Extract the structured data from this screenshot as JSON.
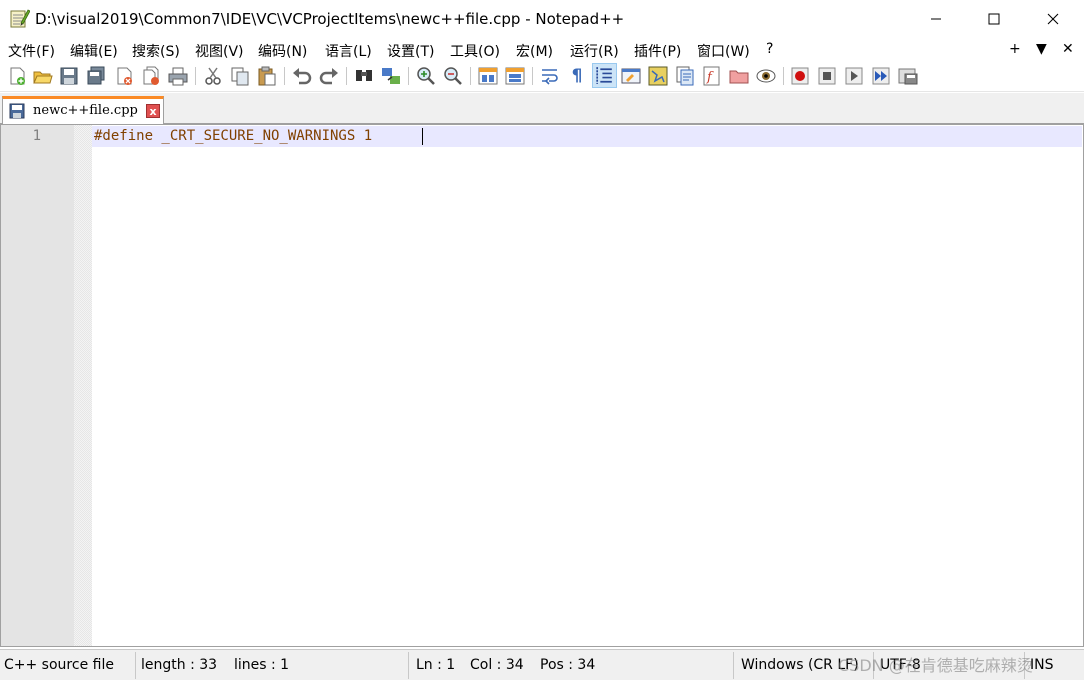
{
  "window": {
    "title": "D:\\visual2019\\Common7\\IDE\\VC\\VCProjectItems\\newc++file.cpp - Notepad++"
  },
  "menu": {
    "items": [
      "文件(F)",
      "编辑(E)",
      "搜索(S)",
      "视图(V)",
      "编码(N)",
      "语言(L)",
      "设置(T)",
      "工具(O)",
      "宏(M)",
      "运行(R)",
      "插件(P)",
      "窗口(W)",
      "?"
    ],
    "right": [
      "+",
      "▼",
      "✕"
    ]
  },
  "toolbar": {
    "icons": [
      "new-file-icon",
      "open-file-icon",
      "save-icon",
      "save-all-icon",
      "close-icon",
      "close-all-icon",
      "print-icon",
      "cut-icon",
      "copy-icon",
      "paste-icon",
      "undo-icon",
      "redo-icon",
      "find-icon",
      "replace-icon",
      "zoom-in-icon",
      "zoom-out-icon",
      "sync-vertical-icon",
      "sync-horizontal-icon",
      "word-wrap-icon",
      "show-all-chars-icon",
      "indent-guide-icon",
      "udl-icon",
      "doc-map-icon",
      "doc-list-icon",
      "function-list-icon",
      "folder-workspace-icon",
      "monitoring-icon",
      "record-macro-icon",
      "stop-macro-icon",
      "play-macro-icon",
      "run-macro-multiple-icon",
      "save-macro-icon"
    ],
    "show_all_chars_glyph": "¶"
  },
  "tabs": [
    {
      "label": "newc++file.cpp",
      "close": "x"
    }
  ],
  "editor": {
    "line_number": "1",
    "code": "#define _CRT_SECURE_NO_WARNINGS 1"
  },
  "status": {
    "file_type": "C++ source file",
    "length": "length : 33",
    "lines": "lines : 1",
    "ln": "Ln : 1",
    "col": "Col : 34",
    "pos": "Pos : 34",
    "eol": "Windows (CR LF)",
    "encoding": "UTF-8",
    "mode": "INS"
  },
  "watermark": "CSDN @在肯德基吃麻辣烫",
  "colors": {
    "tab_accent": "#fa8a25",
    "line_highlight": "#e8e8ff",
    "code_text": "#804000",
    "gutter": "#e4e4e4"
  }
}
